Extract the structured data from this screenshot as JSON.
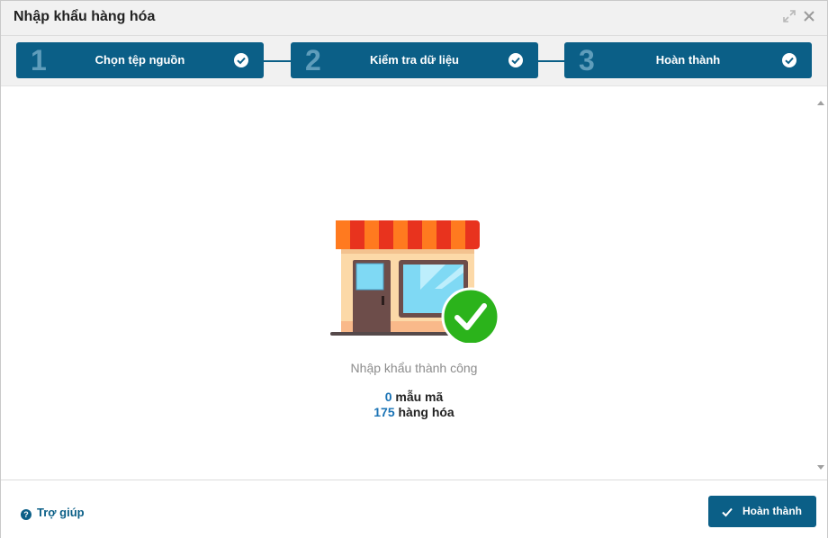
{
  "dialog": {
    "title": "Nhập khẩu hàng hóa"
  },
  "steps": [
    {
      "number": "1",
      "label": "Chọn tệp nguồn",
      "status": "done"
    },
    {
      "number": "2",
      "label": "Kiểm tra dữ liệu",
      "status": "done"
    },
    {
      "number": "3",
      "label": "Hoàn thành",
      "status": "done"
    }
  ],
  "result": {
    "message": "Nhập khẩu thành công",
    "variants_count": "0",
    "variants_label": "mẫu mã",
    "items_count": "175",
    "items_label": "hàng hóa"
  },
  "footer": {
    "help_label": "Trợ giúp",
    "finish_label": "Hoàn thành"
  },
  "colors": {
    "primary": "#0b5f87",
    "accent_number": "#1a73b5",
    "success": "#2bb31b"
  },
  "icons": [
    "expand-icon",
    "close-icon",
    "check-circle-icon",
    "store-icon",
    "success-check-icon",
    "help-icon",
    "check-icon"
  ]
}
